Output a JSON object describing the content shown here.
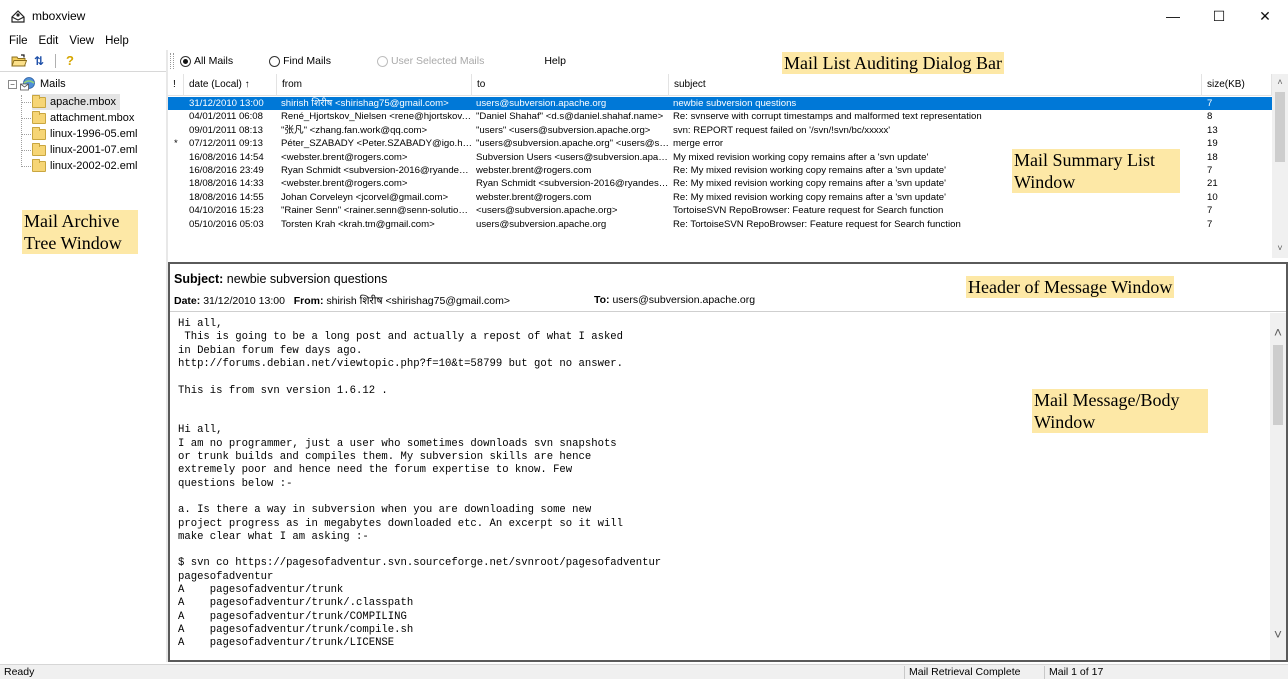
{
  "window": {
    "title": "mboxview",
    "minimize_glyph": "—",
    "maximize_glyph": "☐",
    "close_glyph": "✕"
  },
  "menu": [
    "File",
    "Edit",
    "View",
    "Help"
  ],
  "toolbar": {
    "buttons": [
      "open-folder-icon",
      "refresh-icon",
      "help-icon"
    ],
    "refresh_glyph": "⇅",
    "help_glyph": "?"
  },
  "tree": {
    "root": "Mails",
    "items": [
      "apache.mbox",
      "attachment.mbox",
      "linux-1996-05.eml",
      "linux-2001-07.eml",
      "linux-2002-02.eml"
    ],
    "selected_index": 0
  },
  "dialog_bar": {
    "options": [
      "All Mails",
      "Find Mails",
      "User Selected Mails"
    ],
    "help_label": "Help"
  },
  "annotations": {
    "dialog_bar": "Mail List Auditing Dialog Bar",
    "tree": "Mail Archive Tree Window",
    "summary": "Mail Summary List Window",
    "header": "Header of Message Window",
    "body": "Mail Message/Body Window"
  },
  "mail_list": {
    "columns": [
      "!",
      "date (Local) ↑",
      "from",
      "to",
      "subject",
      "size(KB)"
    ],
    "rows": [
      {
        "flag": "",
        "date": "31/12/2010 13:00",
        "from": "shirish शिरीष <shirishag75@gmail.com>",
        "to": "users@subversion.apache.org",
        "subject": "newbie subversion questions",
        "size": "7"
      },
      {
        "flag": "",
        "date": "04/01/2011 06:08",
        "from": "René_Hjortskov_Nielsen <rene@hjortskov.dk>",
        "to": "\"Daniel Shahaf\" <d.s@daniel.shahaf.name>",
        "subject": "Re: svnserve with corrupt timestamps and malformed text representation",
        "size": "8"
      },
      {
        "flag": "",
        "date": "09/01/2011 08:13",
        "from": "\"张凡\" <zhang.fan.work@qq.com>",
        "to": "\"users\" <users@subversion.apache.org>",
        "subject": "svn: REPORT request failed on '/svn/!svn/bc/xxxxx'",
        "size": "13"
      },
      {
        "flag": "*",
        "date": "07/12/2011 09:13",
        "from": "Péter_SZABADY <Peter.SZABADY@igo.hu>",
        "to": "\"users@subversion.apache.org\" <users@subversion.apache.org>",
        "subject": "merge error",
        "size": "19"
      },
      {
        "flag": "",
        "date": "16/08/2016 14:54",
        "from": "<webster.brent@rogers.com>",
        "to": "Subversion Users <users@subversion.apache.org>",
        "subject": "My mixed revision working copy remains after a 'svn update'",
        "size": "18"
      },
      {
        "flag": "",
        "date": "16/08/2016 23:49",
        "from": "Ryan Schmidt <subversion-2016@ryandesign.com>",
        "to": "webster.brent@rogers.com",
        "subject": "Re: My mixed revision working copy remains after a 'svn update'",
        "size": "7"
      },
      {
        "flag": "",
        "date": "18/08/2016 14:33",
        "from": "<webster.brent@rogers.com>",
        "to": "Ryan Schmidt <subversion-2016@ryandesign.com>",
        "subject": "Re: My mixed revision working copy remains after a 'svn update'",
        "size": "21"
      },
      {
        "flag": "",
        "date": "18/08/2016 14:55",
        "from": "Johan Corveleyn <jcorvel@gmail.com>",
        "to": "webster.brent@rogers.com",
        "subject": "Re: My mixed revision working copy remains after a 'svn update'",
        "size": "10"
      },
      {
        "flag": "",
        "date": "04/10/2016 15:23",
        "from": "\"Rainer Senn\" <rainer.senn@senn-solutions.ch>",
        "to": "<users@subversion.apache.org>",
        "subject": "TortoiseSVN RepoBrowser: Feature request for Search function",
        "size": "7"
      },
      {
        "flag": "",
        "date": "05/10/2016 05:03",
        "from": "Torsten Krah <krah.tm@gmail.com>",
        "to": "users@subversion.apache.org",
        "subject": "Re: TortoiseSVN RepoBrowser: Feature request for Search function",
        "size": "7"
      }
    ],
    "selected_index": 0
  },
  "message": {
    "subject_label": "Subject:",
    "subject": "newbie subversion questions",
    "date_label": "Date:",
    "date": "31/12/2010 13:00",
    "from_label": "From:",
    "from": "shirish शिरीष <shirishag75@gmail.com>",
    "to_label": "To:",
    "to": "users@subversion.apache.org",
    "body": [
      "Hi all,",
      " This is going to be a long post and actually a repost of what I asked",
      "in Debian forum few days ago.",
      "http://forums.debian.net/viewtopic.php?f=10&t=58799 but got no answer.",
      "",
      "This is from svn version 1.6.12 .",
      "",
      "",
      "Hi all,",
      "I am no programmer, just a user who sometimes downloads svn snapshots",
      "or trunk builds and compiles them. My subversion skills are hence",
      "extremely poor and hence need the forum expertise to know. Few",
      "questions below :-",
      "",
      "a. Is there a way in subversion when you are downloading some new",
      "project progress as in megabytes downloaded etc. An excerpt so it will",
      "make clear what I am asking :-",
      "",
      "$ svn co https://pagesofadventur.svn.sourceforge.net/svnroot/pagesofadventur",
      "pagesofadventur",
      "A    pagesofadventur/trunk",
      "A    pagesofadventur/trunk/.classpath",
      "A    pagesofadventur/trunk/COMPILING",
      "A    pagesofadventur/trunk/compile.sh",
      "A    pagesofadventur/trunk/LICENSE"
    ]
  },
  "status": {
    "left": "Ready",
    "retrieval": "Mail Retrieval Complete",
    "position": "Mail 1 of 17"
  },
  "colors": {
    "selection": "#0078d7",
    "annotation_bg": "#fde8a6"
  }
}
